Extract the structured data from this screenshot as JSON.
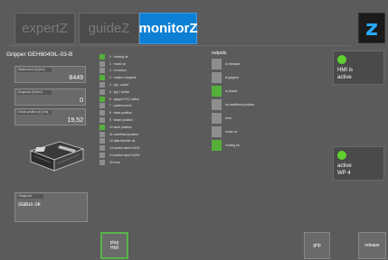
{
  "tabs": [
    {
      "label": "expertZ",
      "active": false
    },
    {
      "label": "guideZ",
      "active": false
    },
    {
      "label": "monitorZ",
      "active": true
    }
  ],
  "logo": {
    "text": "z",
    "color": "#2aa8ff"
  },
  "device": {
    "title": "Gripper GEH6040IL-03-B"
  },
  "fields": {
    "status": {
      "label": "Status word (h) [hex]",
      "value": "8449"
    },
    "diagnosis": {
      "label": "Diagnosis (h) [hex]",
      "value": "0"
    },
    "position": {
      "label": "Actual position (x) [mm]",
      "value": "19,52"
    }
  },
  "diagnosis_box": {
    "label": "Diagnosis",
    "value": "status ok"
  },
  "inputs": [
    {
      "text": "0 · homing ok",
      "on": true
    },
    {
      "text": "1 · motor on",
      "on": false
    },
    {
      "text": "2 · in motion",
      "on": false
    },
    {
      "text": "3 · motion complete",
      "on": true
    },
    {
      "text": "4 · jog - active",
      "on": false
    },
    {
      "text": "5 · jog + active",
      "on": false
    },
    {
      "text": "6 · gripper PLC active",
      "on": true
    },
    {
      "text": "7 · position error",
      "on": false
    },
    {
      "text": "8 · base position",
      "on": false
    },
    {
      "text": "9 · teach position",
      "on": false
    },
    {
      "text": "10 work position",
      "on": true
    },
    {
      "text": "11 undefined position",
      "on": false
    },
    {
      "text": "12 data transfer ok",
      "on": false
    },
    {
      "text": "13 control word 0x100",
      "on": false
    },
    {
      "text": "14 control word 0x200",
      "on": false
    },
    {
      "text": "15 error",
      "on": false
    }
  ],
  "outputs": {
    "title": "outputs",
    "items": [
      {
        "text": "is released",
        "on": false
      },
      {
        "text": "is gripped",
        "on": false
      },
      {
        "text": "is closed",
        "on": true
      },
      {
        "text": "no undefined position",
        "on": false
      },
      {
        "text": "error",
        "on": false
      },
      {
        "text": "motor on",
        "on": false
      },
      {
        "text": "homing ok",
        "on": true
      }
    ]
  },
  "status_panels": {
    "hmi": {
      "line1": "HMI is",
      "line2": "active",
      "color": "#5fd02f"
    },
    "wp": {
      "line1": "active",
      "line2": "WP 4",
      "color": "#5fd02f"
    }
  },
  "buttons": {
    "plug": {
      "line1": "plug",
      "line2": "HMI"
    },
    "grip": "grip",
    "release": "release"
  },
  "colors": {
    "accent": "#0d7fd4",
    "on": "#55b03a",
    "off": "#8e8e8e",
    "background": "#5b5b5b"
  }
}
